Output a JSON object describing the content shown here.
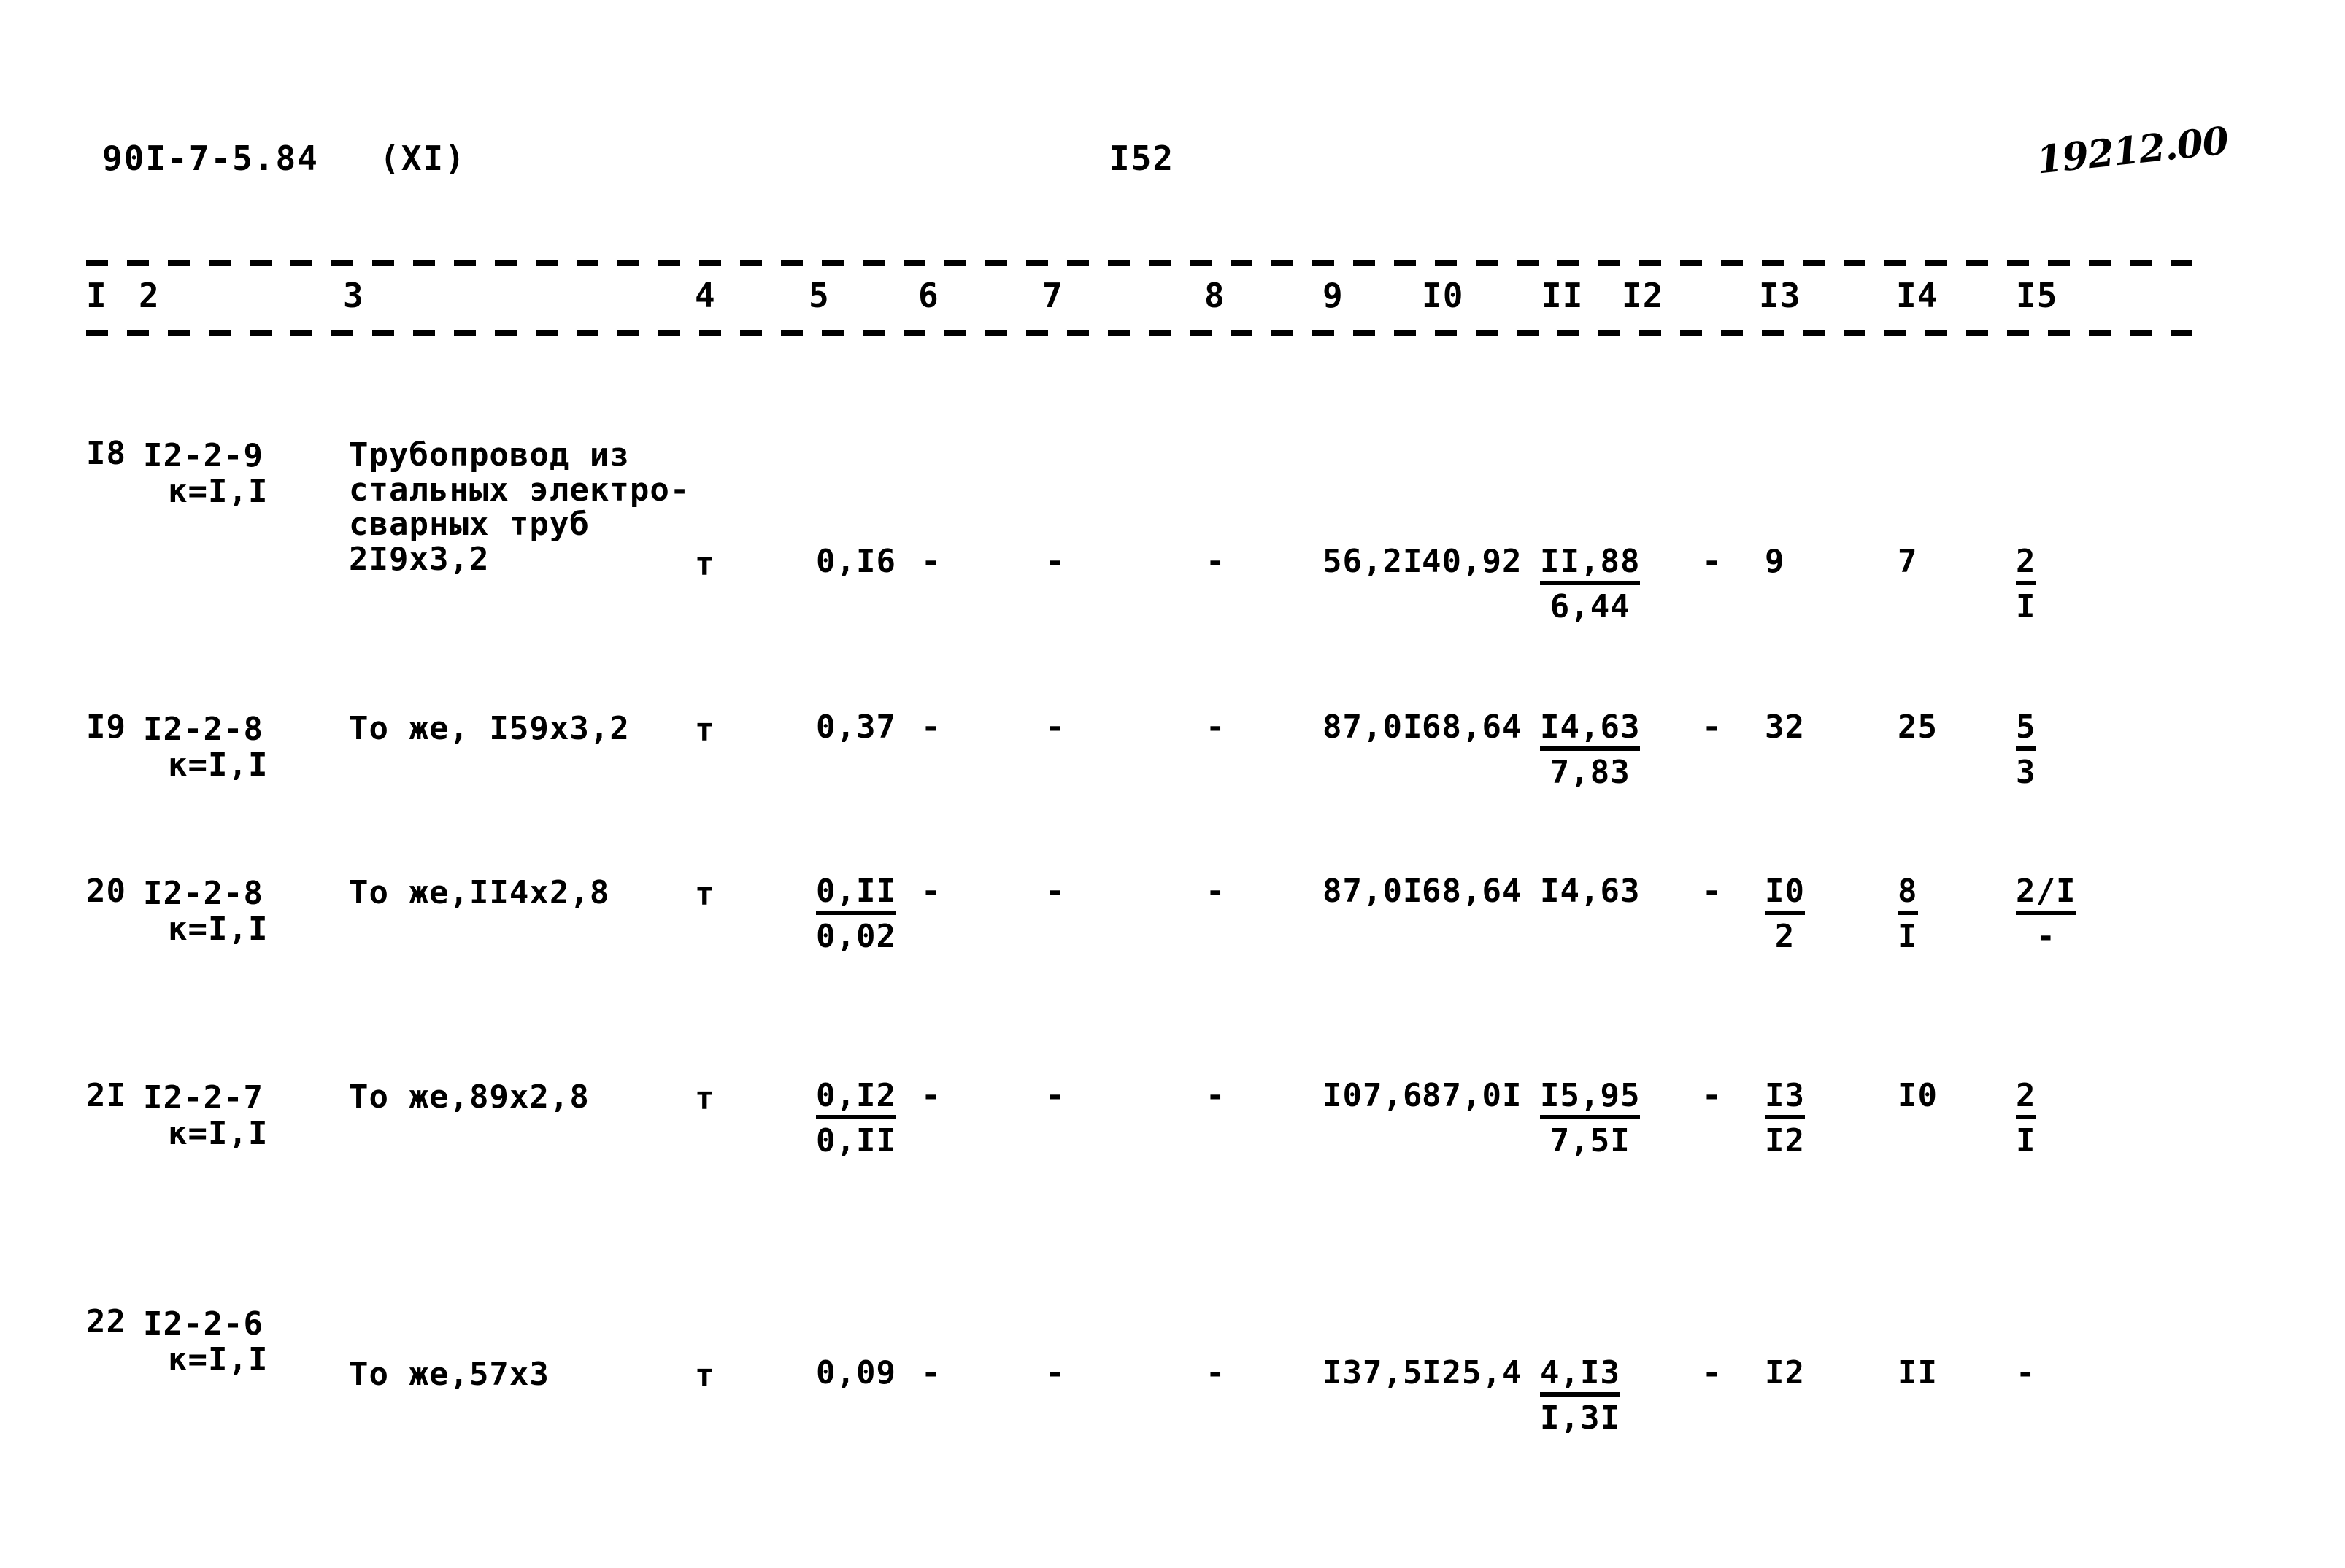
{
  "header": {
    "doc_code": "90I-7-5.84",
    "series": "(XI)",
    "page_number": "I52",
    "hand_note": "19212.00"
  },
  "table": {
    "column_headers": [
      {
        "label": "I",
        "x": 118
      },
      {
        "label": "2",
        "x": 190
      },
      {
        "label": "3",
        "x": 470
      },
      {
        "label": "4",
        "x": 952
      },
      {
        "label": "5",
        "x": 1108
      },
      {
        "label": "6",
        "x": 1258
      },
      {
        "label": "7",
        "x": 1428
      },
      {
        "label": "8",
        "x": 1650
      },
      {
        "label": "9",
        "x": 1812
      },
      {
        "label": "I0",
        "x": 1948
      },
      {
        "label": "II",
        "x": 2112
      },
      {
        "label": "I2",
        "x": 2222
      },
      {
        "label": "I3",
        "x": 2410
      },
      {
        "label": "I4",
        "x": 2598
      },
      {
        "label": "I5",
        "x": 2762
      }
    ],
    "rows": [
      {
        "no": "I8",
        "code": "I2-2-9",
        "coefficient": "к=I,I",
        "description": "Трубопровод из\nстальных электро-\nсварных труб\n2I9х3,2",
        "unit": "т",
        "col5": "0,I6",
        "col6": "-",
        "col7": "-",
        "col8": "-",
        "col9": "56,2I",
        "col10": "40,92",
        "col11_num": "II,88",
        "col11_den": "6,44",
        "col12": "-",
        "col13": "9",
        "col14": "7",
        "col15_num": "2",
        "col15_den": "I"
      },
      {
        "no": "I9",
        "code": "I2-2-8",
        "coefficient": "к=I,I",
        "description": "То же, I59х3,2",
        "unit": "т",
        "col5": "0,37",
        "col6": "-",
        "col7": "-",
        "col8": "-",
        "col9": "87,0I",
        "col10": "68,64",
        "col11_num": "I4,63",
        "col11_den": "7,83",
        "col12": "-",
        "col13": "32",
        "col14": "25",
        "col15_num": "5",
        "col15_den": "3"
      },
      {
        "no": "20",
        "code": "I2-2-8",
        "coefficient": "к=I,I",
        "description": "То же,II4х2,8",
        "unit": "т",
        "col5_num": "0,II",
        "col5_den": "0,02",
        "col6": "-",
        "col7": "-",
        "col8": "-",
        "col9": "87,0I",
        "col10": "68,64",
        "col11": "I4,63",
        "col12": "-",
        "col13_num": "I0",
        "col13_den": "2",
        "col14_num": "8",
        "col14_den": "I",
        "col15_num": "2/I",
        "col15_den": "-"
      },
      {
        "no": "2I",
        "code": "I2-2-7",
        "coefficient": "к=I,I",
        "description": "То же,89х2,8",
        "unit": "т",
        "col5_num": "0,I2",
        "col5_den": "0,II",
        "col6": "-",
        "col7": "-",
        "col8": "-",
        "col9": "I07,6",
        "col10": "87,0I",
        "col11_num": "I5,95",
        "col11_den": "7,5I",
        "col12": "-",
        "col13_num": "I3",
        "col13_den": "I2",
        "col14": "I0",
        "col15_num": "2",
        "col15_den": "I"
      },
      {
        "no": "22",
        "code": "I2-2-6",
        "coefficient": "к=I,I",
        "description": "То же,57х3",
        "unit": "т",
        "col5": "0,09",
        "col6": "-",
        "col7": "-",
        "col8": "-",
        "col9": "I37,5",
        "col10": "I25,4",
        "col11_num": "4,I3",
        "col11_den": "I,3I",
        "col12": "-",
        "col13": "I2",
        "col14": "II",
        "col15": "-"
      }
    ]
  }
}
